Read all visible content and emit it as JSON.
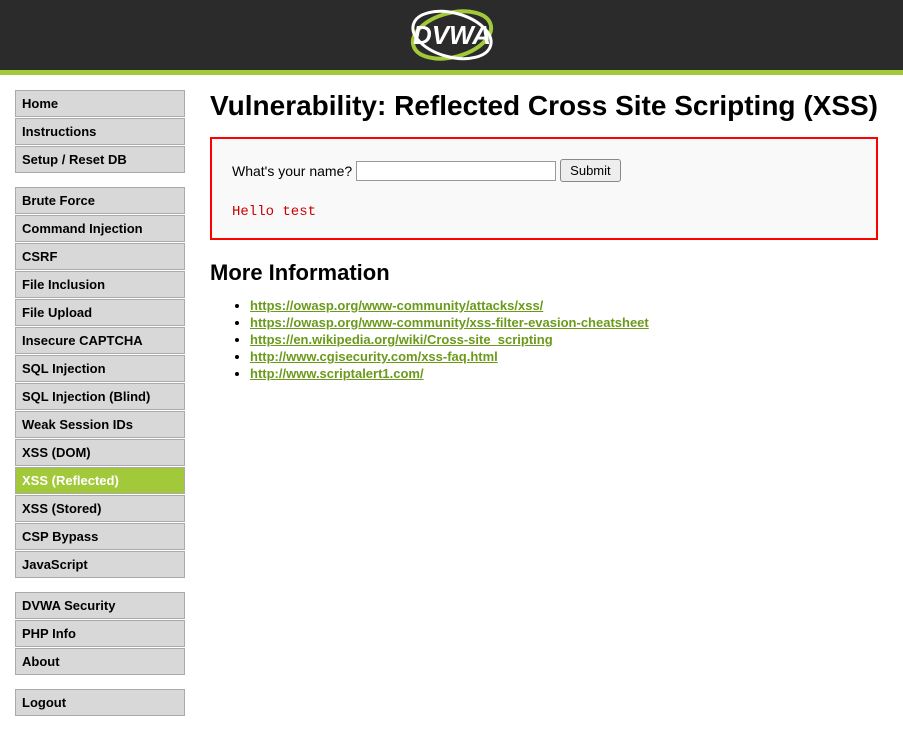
{
  "logo_text": "DVWA",
  "sidebar": {
    "groups": [
      [
        {
          "label": "Home",
          "name": "menu-home",
          "active": false
        },
        {
          "label": "Instructions",
          "name": "menu-instructions",
          "active": false
        },
        {
          "label": "Setup / Reset DB",
          "name": "menu-setup",
          "active": false
        }
      ],
      [
        {
          "label": "Brute Force",
          "name": "menu-brute-force",
          "active": false
        },
        {
          "label": "Command Injection",
          "name": "menu-command-injection",
          "active": false
        },
        {
          "label": "CSRF",
          "name": "menu-csrf",
          "active": false
        },
        {
          "label": "File Inclusion",
          "name": "menu-file-inclusion",
          "active": false
        },
        {
          "label": "File Upload",
          "name": "menu-file-upload",
          "active": false
        },
        {
          "label": "Insecure CAPTCHA",
          "name": "menu-insecure-captcha",
          "active": false
        },
        {
          "label": "SQL Injection",
          "name": "menu-sql-injection",
          "active": false
        },
        {
          "label": "SQL Injection (Blind)",
          "name": "menu-sql-injection-blind",
          "active": false
        },
        {
          "label": "Weak Session IDs",
          "name": "menu-weak-session-ids",
          "active": false
        },
        {
          "label": "XSS (DOM)",
          "name": "menu-xss-dom",
          "active": false
        },
        {
          "label": "XSS (Reflected)",
          "name": "menu-xss-reflected",
          "active": true
        },
        {
          "label": "XSS (Stored)",
          "name": "menu-xss-stored",
          "active": false
        },
        {
          "label": "CSP Bypass",
          "name": "menu-csp-bypass",
          "active": false
        },
        {
          "label": "JavaScript",
          "name": "menu-javascript",
          "active": false
        }
      ],
      [
        {
          "label": "DVWA Security",
          "name": "menu-dvwa-security",
          "active": false
        },
        {
          "label": "PHP Info",
          "name": "menu-php-info",
          "active": false
        },
        {
          "label": "About",
          "name": "menu-about",
          "active": false
        }
      ],
      [
        {
          "label": "Logout",
          "name": "menu-logout",
          "active": false
        }
      ]
    ]
  },
  "content": {
    "page_title": "Vulnerability: Reflected Cross Site Scripting (XSS)",
    "form": {
      "prompt": "What's your name?",
      "input_value": "",
      "submit_label": "Submit",
      "output": "Hello test"
    },
    "more_info_title": "More Information",
    "links": [
      "https://owasp.org/www-community/attacks/xss/",
      "https://owasp.org/www-community/xss-filter-evasion-cheatsheet",
      "https://en.wikipedia.org/wiki/Cross-site_scripting",
      "http://www.cgisecurity.com/xss-faq.html",
      "http://www.scriptalert1.com/"
    ]
  }
}
